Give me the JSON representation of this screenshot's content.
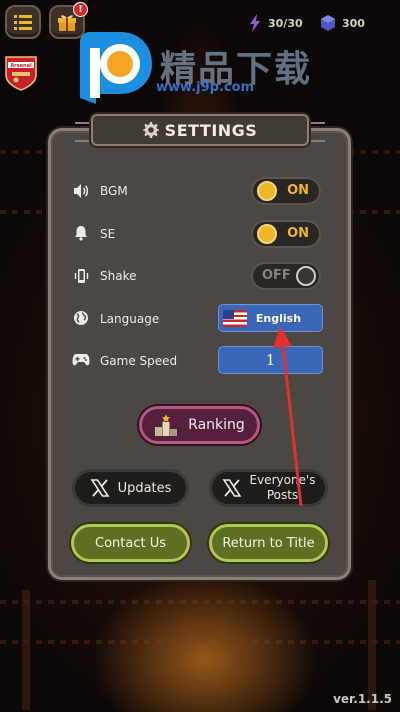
{
  "hud": {
    "energy": "30/30",
    "gems": "300",
    "gift_badge": "!",
    "team_badge_text": "Arsenal"
  },
  "watermark": {
    "brand": "精品下载",
    "url": "www.j9p.com"
  },
  "settings": {
    "title": "SETTINGS",
    "rows": [
      {
        "label": "BGM",
        "icon": "speaker-icon",
        "state": "ON"
      },
      {
        "label": "SE",
        "icon": "bell-icon",
        "state": "ON"
      },
      {
        "label": "Shake",
        "icon": "vibrate-phone-icon",
        "state": "OFF"
      },
      {
        "label": "Language",
        "icon": "globe-icon",
        "value": "English"
      },
      {
        "label": "Game Speed",
        "icon": "gamepad-icon",
        "value": "1"
      }
    ],
    "ranking_label": "Ranking",
    "updates_label": "Updates",
    "posts_label_line1": "Everyone's",
    "posts_label_line2": "Posts",
    "contact_label": "Contact Us",
    "return_label": "Return to Title"
  },
  "version": "ver.1.1.5",
  "colors": {
    "toggle_on": "#f1b52a",
    "select_blue": "#3b67b8",
    "ranking": "#b8567e",
    "green": "#b1c653",
    "arrow": "#e03030"
  }
}
